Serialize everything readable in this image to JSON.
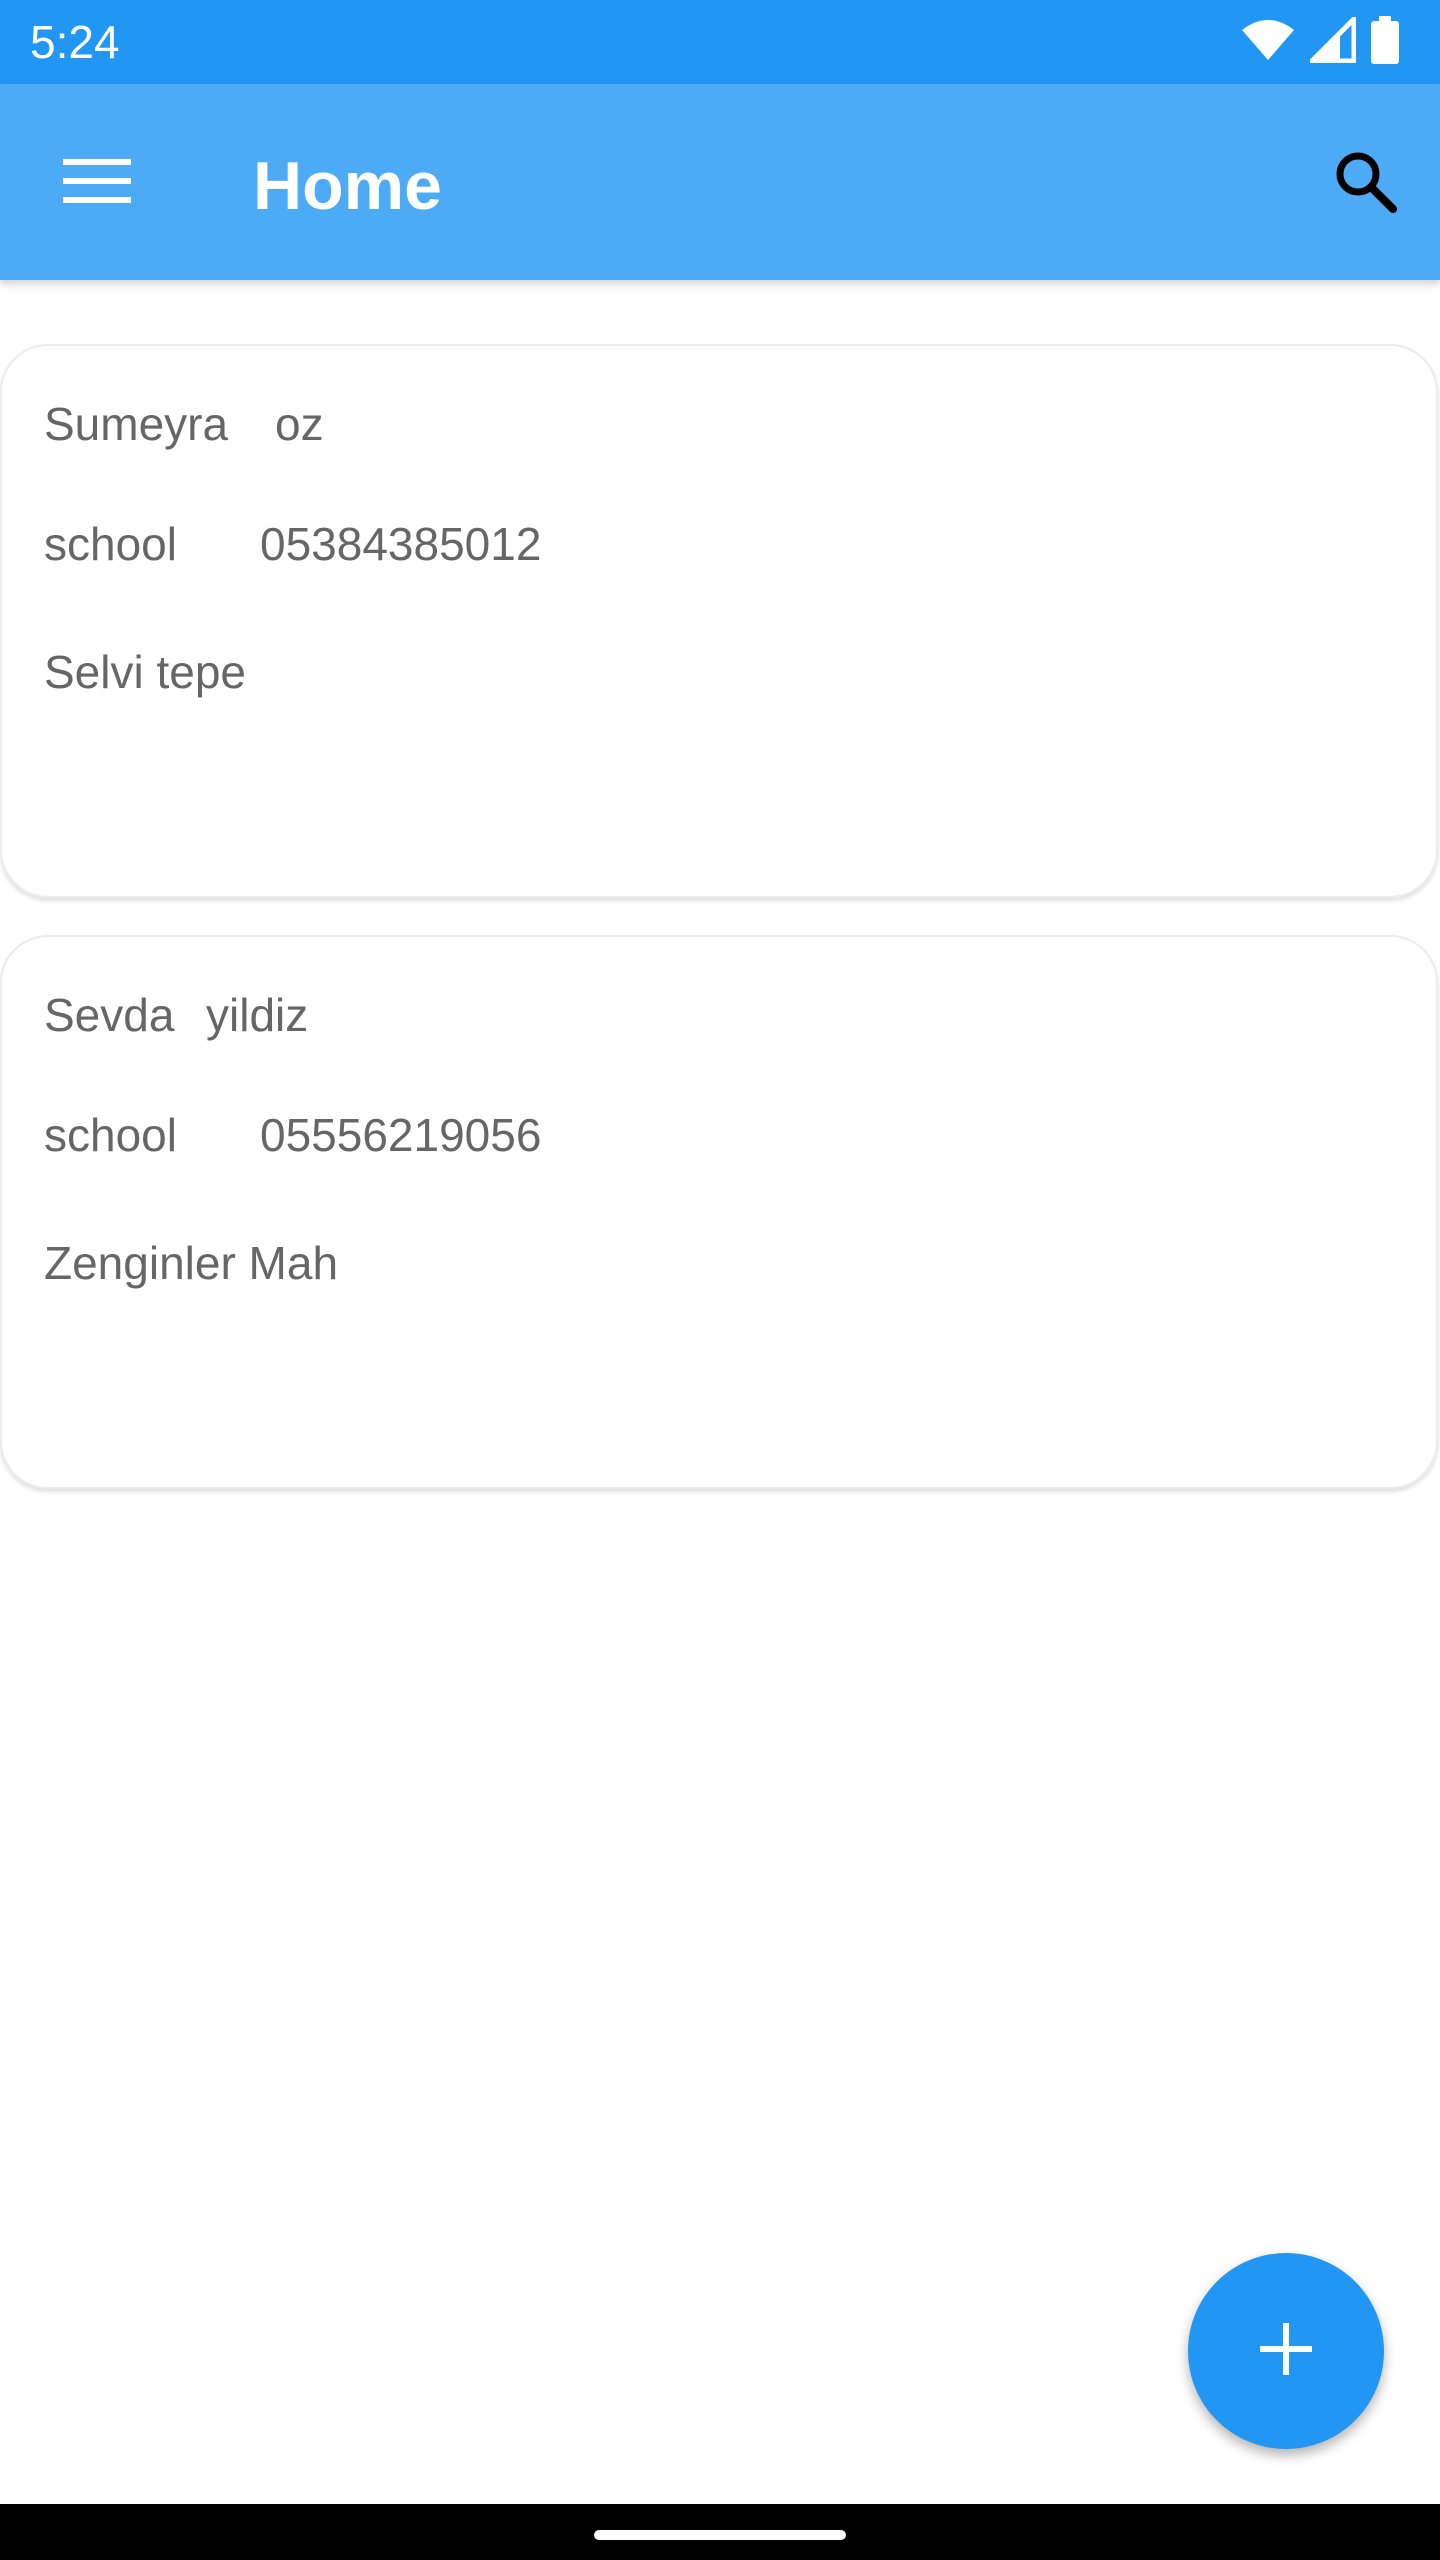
{
  "status_bar": {
    "time": "5:24",
    "icons": [
      "wifi-icon",
      "signal-icon",
      "battery-icon"
    ]
  },
  "app_bar": {
    "title": "Home",
    "menu_icon": "menu-icon",
    "search_icon": "search-icon"
  },
  "contacts": [
    {
      "first_name": "Sumeyra",
      "last_name": "oz",
      "category": "school",
      "phone": "05384385012",
      "address": "Selvi tepe"
    },
    {
      "first_name": "Sevda",
      "last_name": "yildiz",
      "category": "school",
      "phone": "05556219056",
      "address": "Zenginler Mah"
    }
  ],
  "fab": {
    "icon": "plus-icon"
  },
  "colors": {
    "status_bar": "#2196F3",
    "app_bar": "#4DABF5",
    "fab": "#2196F3",
    "card_text": "#666666"
  }
}
